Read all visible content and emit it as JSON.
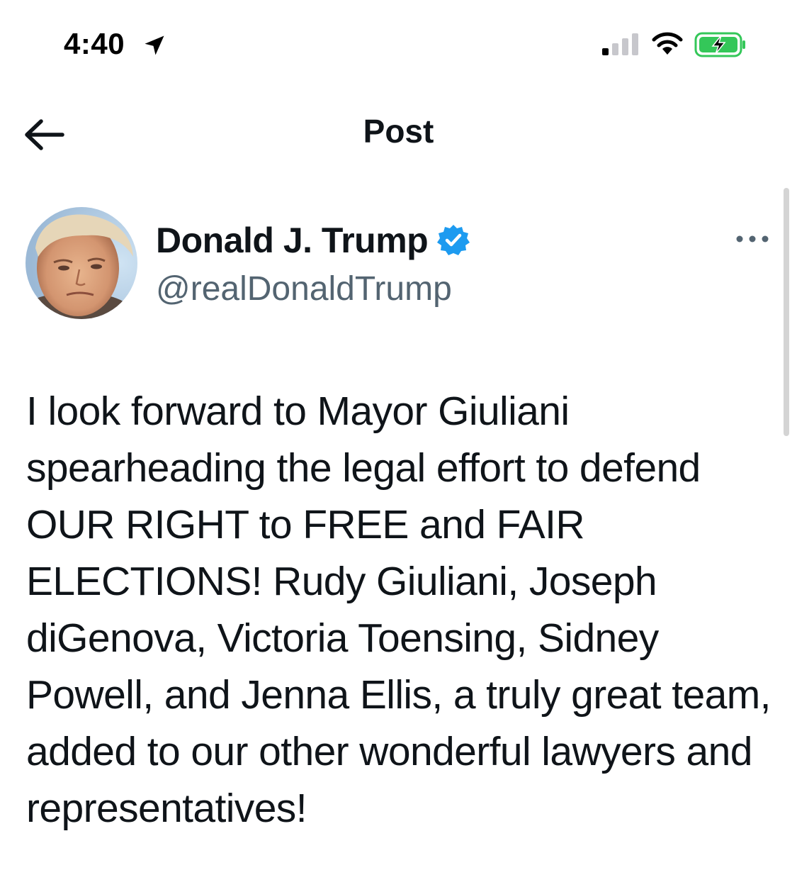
{
  "status_bar": {
    "time": "4:40",
    "icons": [
      "location-arrow-icon",
      "cellular-signal-icon",
      "wifi-icon",
      "battery-charging-icon"
    ],
    "battery_color": "#34c759"
  },
  "header": {
    "title": "Post",
    "back_icon": "arrow-left-icon"
  },
  "author": {
    "name": "Donald J. Trump",
    "handle": "@realDonaldTrump",
    "verified": true,
    "verified_color": "#1d9bf0",
    "avatar": "profile-photo"
  },
  "post": {
    "text": "I look forward to Mayor Giuliani spearheading the legal effort to defend OUR RIGHT to FREE and FAIR ELECTIONS! Rudy Giuliani, Joseph diGenova, Victoria Toensing, Sidney Powell, and Jenna Ellis, a truly great team, added to our other wonderful lawyers and representatives!"
  },
  "colors": {
    "text_primary": "#0f1419",
    "text_secondary": "#536471",
    "background": "#ffffff"
  }
}
